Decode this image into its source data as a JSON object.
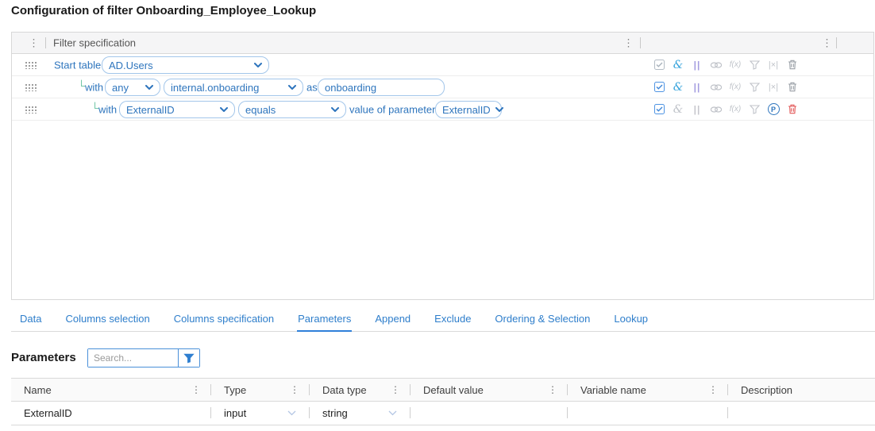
{
  "page_title": "Configuration of filter Onboarding_Employee_Lookup",
  "panel": {
    "title": "Filter specification",
    "rows": {
      "start": {
        "label": "Start table",
        "table": "AD.Users"
      },
      "with1": {
        "label": "with",
        "quantifier": "any",
        "relation": "internal.onboarding",
        "as_label": "as",
        "alias": "onboarding"
      },
      "with2": {
        "label": "with",
        "column": "ExternalID",
        "operator": "equals",
        "value_label": "value of parameter",
        "parameter": "ExternalID"
      }
    }
  },
  "glyphs": {
    "ellipsis": "⋮",
    "tree": "└",
    "and": "&",
    "or": "||",
    "fx": "f(x)",
    "exclude": "|×|",
    "parameter_badge": "P"
  },
  "tabs": {
    "items": [
      {
        "label": "Data",
        "active": false
      },
      {
        "label": "Columns selection",
        "active": false
      },
      {
        "label": "Columns specification",
        "active": false
      },
      {
        "label": "Parameters",
        "active": true
      },
      {
        "label": "Append",
        "active": false
      },
      {
        "label": "Exclude",
        "active": false
      },
      {
        "label": "Ordering & Selection",
        "active": false
      },
      {
        "label": "Lookup",
        "active": false
      }
    ]
  },
  "parameters": {
    "heading": "Parameters",
    "search_placeholder": "Search...",
    "columns": [
      {
        "label": "Name"
      },
      {
        "label": "Type"
      },
      {
        "label": "Data type"
      },
      {
        "label": "Default value"
      },
      {
        "label": "Variable name"
      },
      {
        "label": "Description"
      }
    ],
    "rows": [
      {
        "name": "ExternalID",
        "type": "input",
        "data_type": "string",
        "default_value": "",
        "variable_name": "",
        "description": ""
      }
    ]
  },
  "colors": {
    "accent_blue": "#2e75bd",
    "tab_blue": "#2e7ecb",
    "tab_underline": "#2f80d9",
    "select_border": "#a3c6ea",
    "and_cyan": "#35a3dc",
    "or_purple": "#a49ce0",
    "danger_red": "#e25757",
    "icon_gray": "#c0c3c9",
    "header_bg": "#f5f5f6",
    "tree_green": "#63c09e"
  }
}
